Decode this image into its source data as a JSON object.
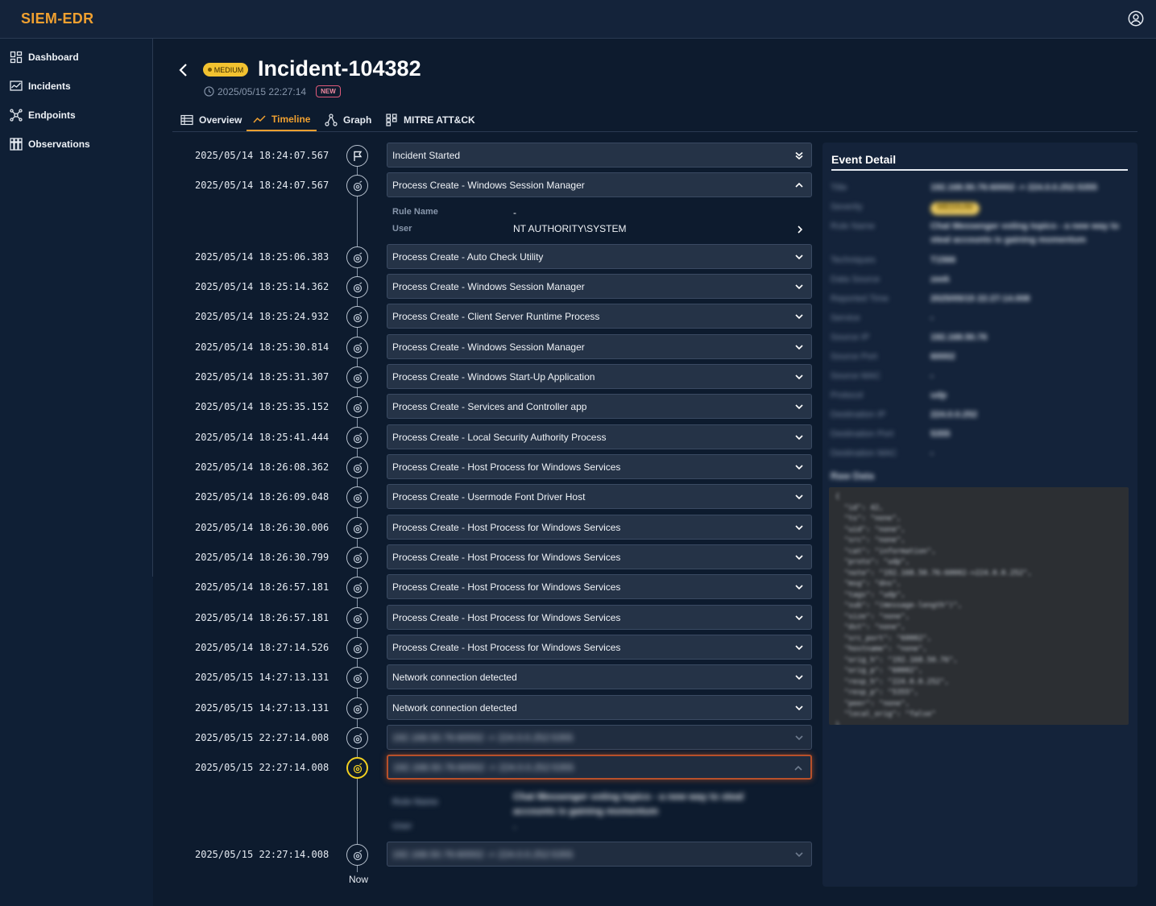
{
  "app": {
    "brand": "SIEM-EDR"
  },
  "sidebar": {
    "items": [
      {
        "label": "Dashboard",
        "icon": "dashboard-icon"
      },
      {
        "label": "Incidents",
        "icon": "incidents-icon"
      },
      {
        "label": "Endpoints",
        "icon": "endpoints-icon"
      },
      {
        "label": "Observations",
        "icon": "observations-icon"
      }
    ]
  },
  "incident": {
    "severity": "MEDIUM",
    "title": "Incident-104382",
    "timestamp": "2025/05/15 22:27:14",
    "status_badge": "NEW"
  },
  "tabs": [
    {
      "label": "Overview",
      "icon": "table-icon"
    },
    {
      "label": "Timeline",
      "icon": "trend-icon",
      "active": true
    },
    {
      "label": "Graph",
      "icon": "graph-icon"
    },
    {
      "label": "MITRE ATT&CK",
      "icon": "grid-icon"
    }
  ],
  "timeline": {
    "events": [
      {
        "time": "2025/05/14 18:24:07.567",
        "label": "Incident Started"
      },
      {
        "time": "2025/05/14 18:24:07.567",
        "label": "Process Create - Windows Session Manager",
        "expanded": true
      },
      {
        "time": "2025/05/14 18:25:06.383",
        "label": "Process Create - Auto Check Utility"
      },
      {
        "time": "2025/05/14 18:25:14.362",
        "label": "Process Create - Windows Session Manager"
      },
      {
        "time": "2025/05/14 18:25:24.932",
        "label": "Process Create - Client Server Runtime Process"
      },
      {
        "time": "2025/05/14 18:25:30.814",
        "label": "Process Create - Windows Session Manager"
      },
      {
        "time": "2025/05/14 18:25:31.307",
        "label": "Process Create - Windows Start-Up Application"
      },
      {
        "time": "2025/05/14 18:25:35.152",
        "label": "Process Create - Services and Controller app"
      },
      {
        "time": "2025/05/14 18:25:41.444",
        "label": "Process Create - Local Security Authority Process"
      },
      {
        "time": "2025/05/14 18:26:08.362",
        "label": "Process Create - Host Process for Windows Services"
      },
      {
        "time": "2025/05/14 18:26:09.048",
        "label": "Process Create - Usermode Font Driver Host"
      },
      {
        "time": "2025/05/14 18:26:30.006",
        "label": "Process Create - Host Process for Windows Services"
      },
      {
        "time": "2025/05/14 18:26:30.799",
        "label": "Process Create - Host Process for Windows Services"
      },
      {
        "time": "2025/05/14 18:26:57.181",
        "label": "Process Create - Host Process for Windows Services"
      },
      {
        "time": "2025/05/14 18:26:57.181",
        "label": "Process Create - Host Process for Windows Services"
      },
      {
        "time": "2025/05/14 18:27:14.526",
        "label": "Process Create - Host Process for Windows Services"
      },
      {
        "time": "2025/05/15 14:27:13.131",
        "label": "Network connection detected"
      },
      {
        "time": "2025/05/15 14:27:13.131",
        "label": "Network connection detected"
      },
      {
        "time": "2025/05/15 22:27:14.008",
        "label": "192.168.50.76:60002 -> 224.0.0.252:5355",
        "blurred": true
      },
      {
        "time": "2025/05/15 22:27:14.008",
        "label": "192.168.50.76:60002 -> 224.0.0.252:5355",
        "blurred": true,
        "selected": true
      },
      {
        "time": "2025/05/15 22:27:14.008",
        "label": "192.168.50.76:60002 -> 224.0.0.252:5355",
        "blurred": true
      }
    ],
    "expanded_detail": {
      "rule_name_label": "Rule Name",
      "rule_name_value": "-",
      "user_label": "User",
      "user_value": "NT AUTHORITY\\SYSTEM"
    },
    "selected_detail": {
      "rule_name_label": "Rule Name",
      "rule_name_value": "Chat Messenger voting topics - a new way to steal accounts is gaining momentum",
      "user_label": "User",
      "user_value": "-"
    },
    "now_label": "Now"
  },
  "event_detail": {
    "title": "Event Detail",
    "fields": [
      {
        "key": "Title",
        "value": "192.168.50.76:60002 -> 224.0.0.252:5355"
      },
      {
        "key": "Severity",
        "value": "MEDIUM"
      },
      {
        "key": "Rule Name",
        "value": "Chat Messenger voting topics - a new way to steal accounts is gaining momentum"
      },
      {
        "key": "Techniques",
        "value": "T1566"
      },
      {
        "key": "Data Source",
        "value": "zeek"
      },
      {
        "key": "Reported Time",
        "value": "2025/05/15 22:27:14.008"
      },
      {
        "key": "Service",
        "value": "-"
      },
      {
        "key": "Source IP",
        "value": "192.168.50.76"
      },
      {
        "key": "Source Port",
        "value": "60002"
      },
      {
        "key": "Source MAC",
        "value": "-"
      },
      {
        "key": "Protocol",
        "value": "udp"
      },
      {
        "key": "Destination IP",
        "value": "224.0.0.252"
      },
      {
        "key": "Destination Port",
        "value": "5355"
      },
      {
        "key": "Destination MAC",
        "value": "-"
      }
    ],
    "raw_data_label": "Raw Data",
    "raw_data": "{\n  \"id\": 42,\n  \"ts\": \"none\",\n  \"uid\": \"none\",\n  \"src\": \"none\",\n  \"cat\": \"information\",\n  \"proto\": \"udp\",\n  \"note\": \"192.168.50.76:60002->224.0.0.252\",\n  \"msg\": \"dns\",\n  \"tags\": \"udp\",\n  \"sub\": \"(message-length\")\",\n  \"size\": \"none\",\n  \"dst\": \"none\",\n  \"src_port\": \"60002\",\n  \"hostname\": \"none\",\n  \"orig_h\": \"192.168.50.76\",\n  \"orig_p\": \"60002\",\n  \"resp_h\": \"224.0.0.252\",\n  \"resp_p\": \"5355\",\n  \"peer\": \"none\",\n  \"local_orig\": \"false\"\n}"
  }
}
